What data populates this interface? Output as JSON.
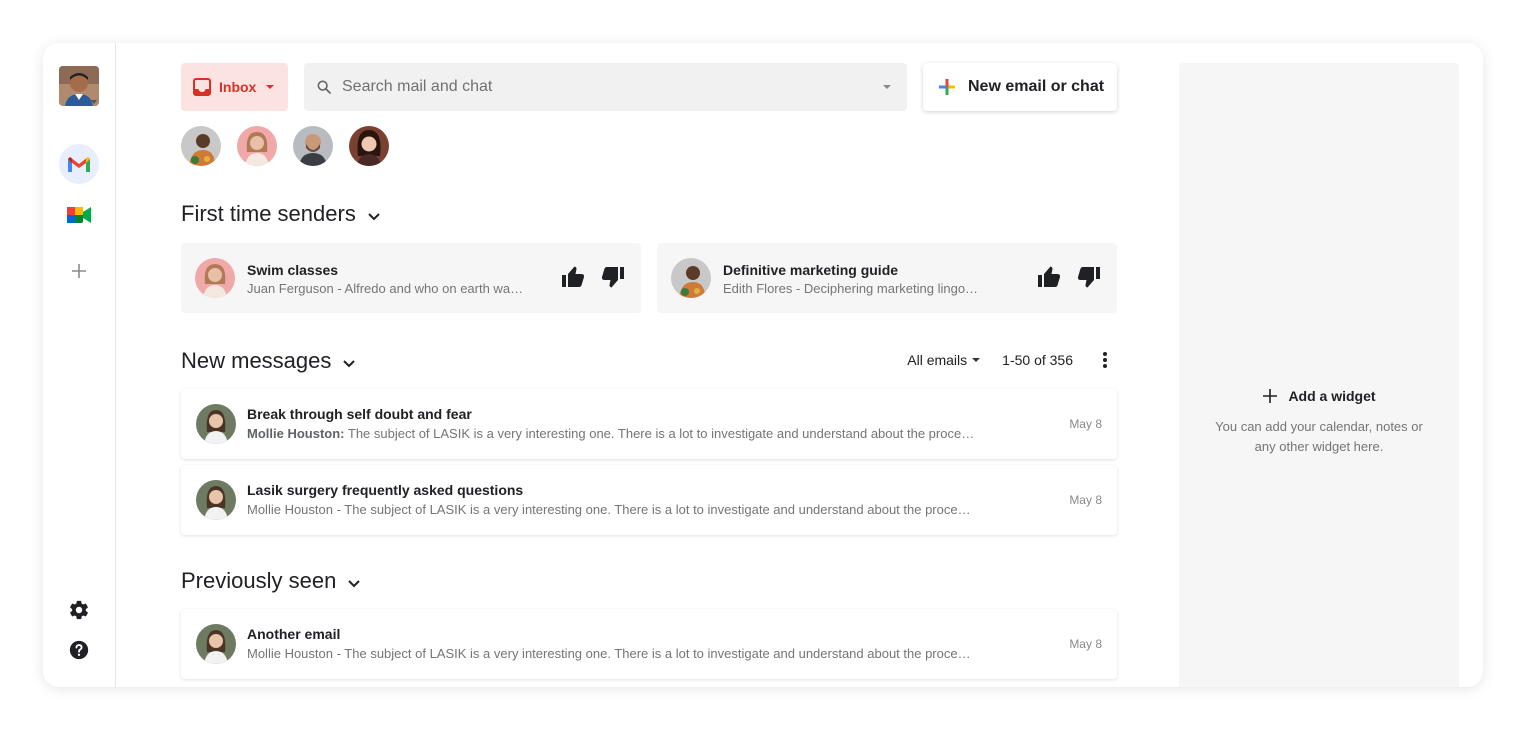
{
  "rail": {
    "apps": [
      "gmail-icon",
      "google-meet-icon"
    ],
    "add_icon": "plus-icon",
    "settings_icon": "gear-icon",
    "help_icon": "help-icon"
  },
  "topbar": {
    "inbox_label": "Inbox",
    "search_placeholder": "Search mail and chat",
    "new_label": "New email or chat"
  },
  "first_time_senders": {
    "title": "First time senders",
    "cards": [
      {
        "subject": "Swim classes",
        "snippet": "Juan Ferguson - Alfredo and who on earth was…"
      },
      {
        "subject": "Definitive marketing guide",
        "snippet": "Edith Flores - Deciphering marketing lingo…"
      }
    ]
  },
  "new_messages": {
    "title": "New messages",
    "filter": "All emails",
    "range": "1-50 of 356",
    "items": [
      {
        "subject": "Break through self doubt and fear",
        "sender": "Mollie Houston:",
        "snippet": " The subject of LASIK is a very interesting one. There is a lot to investigate and understand about the process…",
        "date": "May 8"
      },
      {
        "subject": "Lasik surgery frequently asked questions",
        "snippet": "Mollie Houston - The subject of LASIK is a very interesting one. There is a lot to investigate and understand about the process…",
        "date": "May 8"
      }
    ]
  },
  "previously_seen": {
    "title": "Previously seen",
    "items": [
      {
        "subject": "Another email",
        "snippet": "Mollie Houston - The subject of LASIK is a very interesting one. There is a lot to investigate and understand about the process…",
        "date": "May 8"
      }
    ]
  },
  "widget": {
    "add_label": "Add a widget",
    "desc": "You can add your calendar, notes or any other widget here."
  },
  "colors": {
    "inbox_bg": "#fbe3e2",
    "inbox_text": "#d93025",
    "panel_bg": "#f6f6f6"
  }
}
